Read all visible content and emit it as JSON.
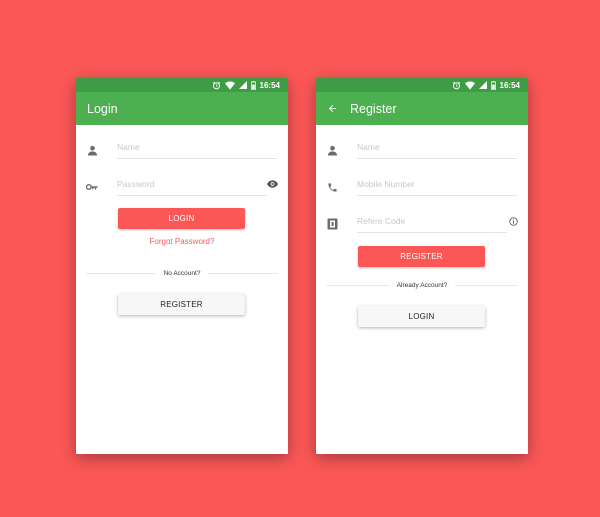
{
  "status_bar": {
    "time": "16:54"
  },
  "login_screen": {
    "title": "Login",
    "name_placeholder": "Name",
    "password_placeholder": "Password",
    "login_button": "LOGIN",
    "forgot_password": "Forgot Password?",
    "divider_text": "No Account?",
    "register_button": "REGISTER"
  },
  "register_screen": {
    "title": "Register",
    "name_placeholder": "Name",
    "mobile_placeholder": "Mobile Number",
    "refer_code_placeholder": "Refere Code",
    "register_button": "REGISTER",
    "divider_text": "Already Account?",
    "login_button": "LOGIN"
  },
  "icons": {
    "status": [
      "alarm-icon",
      "wifi-icon",
      "signal-icon",
      "battery-icon"
    ],
    "login_fields": [
      "person-icon",
      "key-icon",
      "eye-icon"
    ],
    "register_fields": [
      "back-arrow-icon",
      "person-icon",
      "phone-icon",
      "card-icon",
      "info-icon"
    ]
  },
  "colors": {
    "background": "#fb5757",
    "app_bar": "#4caf50",
    "status_bar": "#3f9c45",
    "primary_button": "#fb5757",
    "secondary_button": "#f7f7f7",
    "link": "#fb5757"
  }
}
